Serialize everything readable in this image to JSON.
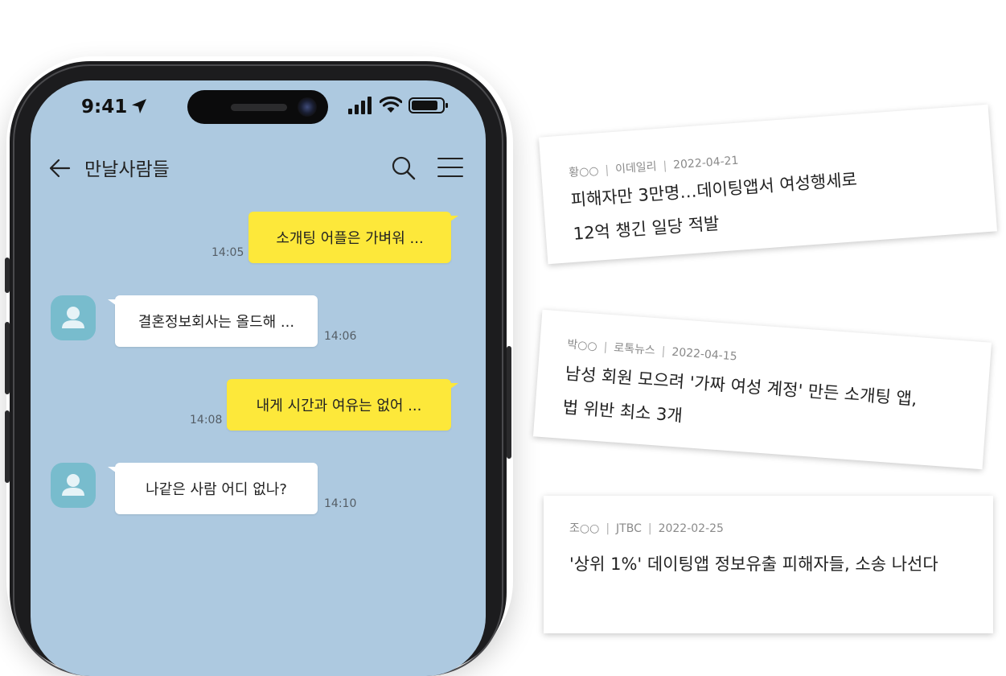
{
  "status_bar": {
    "time": "9:41"
  },
  "chat": {
    "title": "만날사람들",
    "messages": [
      {
        "sender": "me",
        "text": "소개팅 어플은 가벼워 ...",
        "time": "14:05"
      },
      {
        "sender": "other",
        "text": "결혼정보회사는 올드해 ...",
        "time": "14:06"
      },
      {
        "sender": "me",
        "text": "내게 시간과 여유는 없어 ...",
        "time": "14:08"
      },
      {
        "sender": "other",
        "text": "나같은 사람 어디 없나?",
        "time": "14:10"
      }
    ]
  },
  "news": [
    {
      "author": "황○○",
      "outlet": "이데일리",
      "date": "2022-04-21",
      "headline_lines": [
        "피해자만 3만명…데이팅앱서 여성행세로",
        "12억 챙긴 일당 적발"
      ]
    },
    {
      "author": "박○○",
      "outlet": "로톡뉴스",
      "date": "2022-04-15",
      "headline_lines": [
        "남성 회원 모으려 '가짜 여성 계정' 만든 소개팅 앱,",
        "법 위반 최소 3개"
      ]
    },
    {
      "author": "조○○",
      "outlet": "JTBC",
      "date": "2022-02-25",
      "headline_lines": [
        "'상위 1%' 데이팅앱 정보유출 피해자들, 소송 나선다"
      ]
    }
  ],
  "colors": {
    "screen_bg": "#adc9e0",
    "my_bubble": "#fde83a",
    "other_bubble": "#ffffff",
    "avatar": "#78bccd",
    "phone_frame": "#1c1c1e"
  },
  "icons": [
    "location-arrow-icon",
    "signal-icon",
    "wifi-icon",
    "battery-icon",
    "back-arrow-icon",
    "search-icon",
    "hamburger-menu-icon",
    "person-icon"
  ]
}
